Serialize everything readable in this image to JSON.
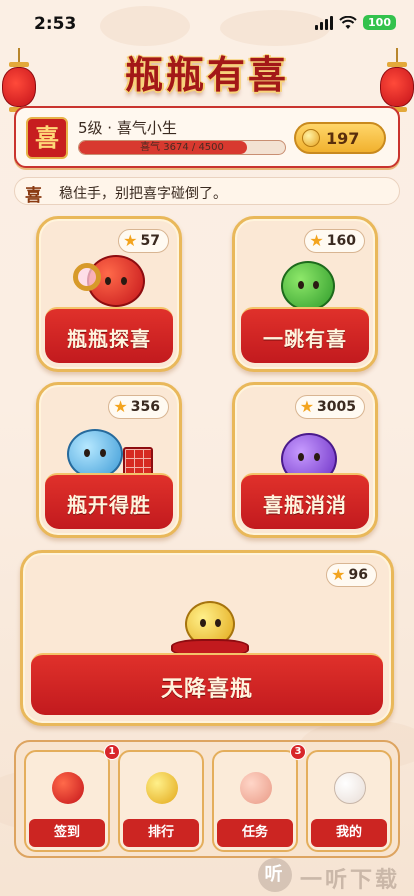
{
  "status_bar": {
    "time": "2:53",
    "battery": "100"
  },
  "header": {
    "title": "瓶瓶有喜"
  },
  "profile": {
    "avatar_char": "喜",
    "level_text": "5级 · 喜气小生",
    "xp_text": "喜气 3674 / 4500",
    "xp_progress": 0.816,
    "coins": "197"
  },
  "tip": {
    "icon": "喜",
    "text": "稳住手，别把喜字碰倒了。"
  },
  "games": [
    {
      "label": "瓶瓶探喜",
      "stars": "57"
    },
    {
      "label": "一跳有喜",
      "stars": "160"
    },
    {
      "label": "瓶开得胜",
      "stars": "356"
    },
    {
      "label": "喜瓶消消",
      "stars": "3005"
    },
    {
      "label": "天降喜瓶",
      "stars": "96"
    }
  ],
  "nav": [
    {
      "label": "签到",
      "badge": "1"
    },
    {
      "label": "排行"
    },
    {
      "label": "任务",
      "badge": "3"
    },
    {
      "label": "我的"
    }
  ],
  "watermark": {
    "icon": "听",
    "text": "一听下载"
  },
  "colors": {
    "primary_red": "#c71e1f",
    "gold": "#e9b85a",
    "background": "#fbefe4"
  }
}
